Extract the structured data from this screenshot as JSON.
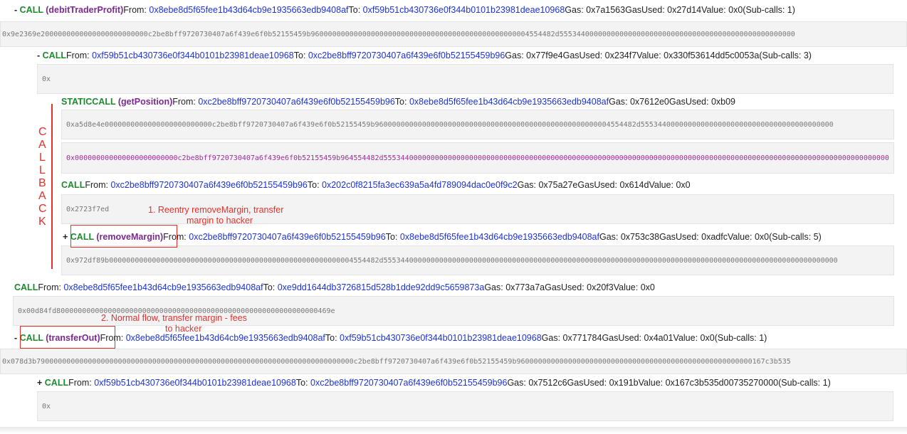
{
  "labels": {
    "from": "From: ",
    "to": "To: ",
    "gas": "Gas: ",
    "gas_used": "GasUsed: ",
    "value": "Value: "
  },
  "calls": [
    {
      "prefix": "- ",
      "type": "CALL",
      "fn": " (debitTraderProfit)",
      "from": "0x8ebe8d5f65fee1b43d64cb9e1935663edb9408af",
      "to": "0xf59b51cb430736e0f344b0101b23981deae10968",
      "gas": "0x7a1563",
      "gas_used": "0x27d14",
      "value": "0x0",
      "subcalls": "(Sub-calls: 1)",
      "data": "0x9e2369e2000000000000000000000000c2be8bff9720730407a6f439e6f0b52155459b960000000000000000000000000000000000000000000000004554482d5553440000000000000000000000000000000000000000000000000"
    },
    {
      "prefix": "- ",
      "type": "CALL",
      "fn": "",
      "from": "0xf59b51cb430736e0f344b0101b23981deae10968",
      "to": "0xc2be8bff9720730407a6f439e6f0b52155459b96",
      "gas": "0x77f9e4",
      "gas_used": "0x234f7",
      "value": "0x330f53614dd5c0053a",
      "subcalls": "(Sub-calls: 3)",
      "data": "0x"
    },
    {
      "prefix": "",
      "type": "STATICCALL",
      "fn": " (getPosition)",
      "from": "0xc2be8bff9720730407a6f439e6f0b52155459b96",
      "to": "0x8ebe8d5f65fee1b43d64cb9e1935663edb9408af",
      "gas": "0x7612e0",
      "gas_used": "0xb09",
      "value": "",
      "subcalls": "",
      "data": "0xa5d8e4e0000000000000000000000000c2be8bff9720730407a6f439e6f0b52155459b9600000000000000000000000000000000000000000000000000004554482d555344000000000000000000000000000000000000000",
      "data2": "0x000000000000000000000000c2be8bff9720730407a6f439e6f0b52155459b964554482d5553440000000000000000000000000000000000000000000000000000000000000000000000000000000000000000000000000000000000000000"
    },
    {
      "prefix": "",
      "type": "CALL",
      "fn": "",
      "from": "0xc2be8bff9720730407a6f439e6f0b52155459b96",
      "to": "0x202c0f8215fa3ec639a5a4fd789094dac0e0f9c2",
      "gas": "0x75a27e",
      "gas_used": "0x614d",
      "value": "0x0",
      "subcalls": "",
      "data": "0x2723f7ed"
    },
    {
      "prefix": "+ ",
      "type": "CALL",
      "fn": " (removeMargin)",
      "from": "0xc2be8bff9720730407a6f439e6f0b52155459b96",
      "to": "0x8ebe8d5f65fee1b43d64cb9e1935663edb9408af",
      "gas": "0x753c38",
      "gas_used": "0xadfc",
      "value": "0x0",
      "subcalls": "(Sub-calls: 5)",
      "data": "0x972df89b000000000000000000000000000000000000000000000000000000004554482d5553440000000000000000000000000000000000000000000000000000000000000000000000000000000000000000000000000000"
    },
    {
      "prefix": "",
      "type": "CALL",
      "fn": "",
      "from": "0x8ebe8d5f65fee1b43d64cb9e1935663edb9408af",
      "to": "0xe9dd1644db3726815d528b1dde92dd9c5659873a",
      "gas": "0x773a7a",
      "gas_used": "0x20f3",
      "value": "0x0",
      "subcalls": "",
      "data": "0x00d84fd8000000000000000000000000000000000000000000000000000000000000469e"
    },
    {
      "prefix": "- ",
      "type": "CALL",
      "fn": " (transferOut)",
      "from": "0x8ebe8d5f65fee1b43d64cb9e1935663edb9408af",
      "to": "0xf59b51cb430736e0f344b0101b23981deae10968",
      "gas": "0x771784",
      "gas_used": "0x4a01",
      "value": "0x0",
      "subcalls": "(Sub-calls: 1)",
      "data": "0x078d3b79000000000000000000000000000000000000000000000000000000000000000000000000c2be8bff9720730407a6f439e6f0b52155459b9600000000000000000000000000000000000000000000000000000167c3b535"
    },
    {
      "prefix": "+ ",
      "type": "CALL",
      "fn": "",
      "from": "0xf59b51cb430736e0f344b0101b23981deae10968",
      "to": "0xc2be8bff9720730407a6f439e6f0b52155459b96",
      "gas": "0x7512c6",
      "gas_used": "0x191b",
      "value": "0x167c3b535d00735270000",
      "subcalls": "(Sub-calls: 1)",
      "data": "0x"
    }
  ],
  "annotations": {
    "callback_letters": [
      "C",
      "A",
      "L",
      "L",
      "B",
      "A",
      "C",
      "K"
    ],
    "note1_line1": "1. Reentry removeMargin, transfer",
    "note1_line2": "margin to hacker",
    "note2_line1": "2. Normal flow, transfer  margin - fees",
    "note2_line2": "to hacker"
  },
  "colors": {
    "call_keyword": "#1e8a2e",
    "function_name": "#7b2a8f",
    "address": "#1c33d6",
    "annotation": "#e0312c",
    "data_box_bg": "#f3f3f3"
  }
}
